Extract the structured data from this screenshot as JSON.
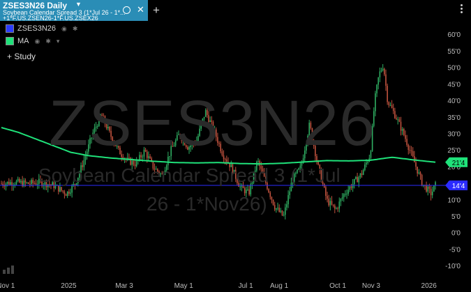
{
  "tab": {
    "title": "ZSES3N26 Daily",
    "subtitle_line1": "Soybean Calendar Spread 3 (1*Jul 26 - 1*...",
    "subtitle_line2": "+1*F.US.ZSEN26-1*F.US.ZSEX26",
    "close_glyph": "✕",
    "add_glyph": "+"
  },
  "legend": {
    "items": [
      {
        "label": "ZSES3N26",
        "color": "#2a3bff"
      },
      {
        "label": "MA",
        "color": "#1fe27a"
      }
    ],
    "study_label": "+ Study"
  },
  "watermark": {
    "symbol": "ZSES3N26",
    "description_line1": "Soybean Calendar Spread 3 (1*Jul",
    "description_line2": "26 - 1*Nov26)"
  },
  "colors": {
    "background": "#000000",
    "up": "#2fae62",
    "down": "#c0523e",
    "ma": "#1fe27a",
    "last_price_line": "#2b2bff",
    "tab": "#2a8db6"
  },
  "chart_data": {
    "type": "candlestick",
    "y_axis_labels": [
      "60'0",
      "55'0",
      "50'0",
      "45'0",
      "40'0",
      "35'0",
      "30'0",
      "25'0",
      "20'0",
      "15'0",
      "10'0",
      "5'0",
      "0'0",
      "-5'0",
      "-10'0"
    ],
    "ylim": [
      -12.5,
      63
    ],
    "x_axis_labels": [
      "Nov 1",
      "2025",
      "Mar 3",
      "May 1",
      "Jul 1",
      "Aug 1",
      "Oct 1",
      "Nov 3",
      "2026"
    ],
    "last_price": {
      "label": "14'4",
      "value": 14.5
    },
    "ma_value": {
      "label": "21'4",
      "value": 21.5
    },
    "price_path": [
      [
        0.0,
        15.0
      ],
      [
        0.03,
        15.5
      ],
      [
        0.06,
        15.0
      ],
      [
        0.09,
        15.5
      ],
      [
        0.12,
        14.5
      ],
      [
        0.15,
        12.0
      ],
      [
        0.17,
        15.0
      ],
      [
        0.19,
        22.0
      ],
      [
        0.21,
        30.0
      ],
      [
        0.23,
        36.0
      ],
      [
        0.25,
        30.0
      ],
      [
        0.27,
        25.0
      ],
      [
        0.29,
        22.0
      ],
      [
        0.31,
        21.0
      ],
      [
        0.33,
        25.0
      ],
      [
        0.35,
        20.0
      ],
      [
        0.37,
        17.5
      ],
      [
        0.39,
        25.0
      ],
      [
        0.41,
        30.0
      ],
      [
        0.43,
        26.0
      ],
      [
        0.45,
        28.0
      ],
      [
        0.47,
        37.0
      ],
      [
        0.49,
        31.0
      ],
      [
        0.51,
        24.0
      ],
      [
        0.53,
        20.0
      ],
      [
        0.55,
        14.0
      ],
      [
        0.57,
        12.0
      ],
      [
        0.59,
        22.0
      ],
      [
        0.61,
        15.0
      ],
      [
        0.63,
        8.0
      ],
      [
        0.65,
        5.0
      ],
      [
        0.67,
        16.0
      ],
      [
        0.69,
        20.0
      ],
      [
        0.71,
        33.0
      ],
      [
        0.73,
        20.0
      ],
      [
        0.75,
        10.0
      ],
      [
        0.77,
        7.0
      ],
      [
        0.79,
        12.0
      ],
      [
        0.81,
        15.0
      ],
      [
        0.83,
        18.0
      ],
      [
        0.85,
        24.0
      ],
      [
        0.86,
        40.0
      ],
      [
        0.87,
        48.0
      ],
      [
        0.88,
        51.0
      ],
      [
        0.89,
        40.0
      ],
      [
        0.91,
        35.0
      ],
      [
        0.93,
        29.0
      ],
      [
        0.95,
        22.0
      ],
      [
        0.97,
        15.0
      ],
      [
        0.99,
        12.0
      ],
      [
        1.0,
        14.5
      ]
    ],
    "ma_path": [
      [
        0.0,
        32.0
      ],
      [
        0.04,
        30.5
      ],
      [
        0.08,
        28.5
      ],
      [
        0.12,
        26.5
      ],
      [
        0.16,
        24.5
      ],
      [
        0.2,
        23.5
      ],
      [
        0.25,
        22.8
      ],
      [
        0.3,
        22.3
      ],
      [
        0.35,
        21.8
      ],
      [
        0.4,
        21.4
      ],
      [
        0.45,
        21.3
      ],
      [
        0.5,
        21.4
      ],
      [
        0.55,
        21.1
      ],
      [
        0.6,
        21.0
      ],
      [
        0.65,
        21.2
      ],
      [
        0.7,
        21.6
      ],
      [
        0.75,
        22.0
      ],
      [
        0.8,
        21.9
      ],
      [
        0.85,
        22.1
      ],
      [
        0.9,
        23.0
      ],
      [
        0.95,
        22.2
      ],
      [
        1.0,
        21.5
      ]
    ],
    "candle_count": 290
  }
}
